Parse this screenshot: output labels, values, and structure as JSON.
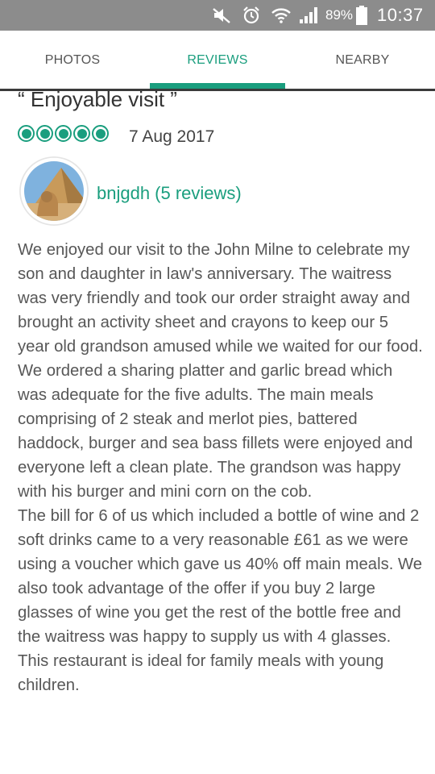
{
  "status_bar": {
    "battery_percent": "89%",
    "time": "10:37",
    "icons": [
      "mute-icon",
      "alarm-icon",
      "wifi-icon",
      "signal-icon",
      "battery-icon"
    ]
  },
  "tabs": [
    {
      "label": "PHOTOS",
      "active": false
    },
    {
      "label": "REVIEWS",
      "active": true
    },
    {
      "label": "NEARBY",
      "active": false
    }
  ],
  "review": {
    "title": "“ Enjoyable visit ”",
    "rating": 5,
    "date": "7 Aug 2017",
    "reviewer": "bnjgdh (5 reviews)",
    "paragraphs": [
      "We enjoyed our visit to the John Milne to celebrate my son and daughter in law's anniversary. The waitress was very friendly and took our order straight away and brought an activity sheet and crayons to keep our 5 year old grandson amused while we waited for our food. We ordered a sharing platter and garlic bread which was adequate for the five adults. The main meals comprising of 2 steak and merlot pies, battered haddock, burger and sea bass fillets were enjoyed and everyone left a clean plate. The grandson was happy with his burger and mini corn on the cob.",
      "The bill for 6 of us which included a bottle of wine and 2 soft drinks came to a very reasonable £61 as we were using a voucher which gave us 40% off main meals. We also took advantage of the offer if you buy 2 large glasses of wine you get the rest of the bottle free and the waitress was happy to supply us with 4 glasses. This restaurant is ideal for family meals with young children."
    ]
  },
  "colors": {
    "accent": "#1a9e7e",
    "status_bar": "#8c8c8c",
    "body_text": "#575757"
  }
}
